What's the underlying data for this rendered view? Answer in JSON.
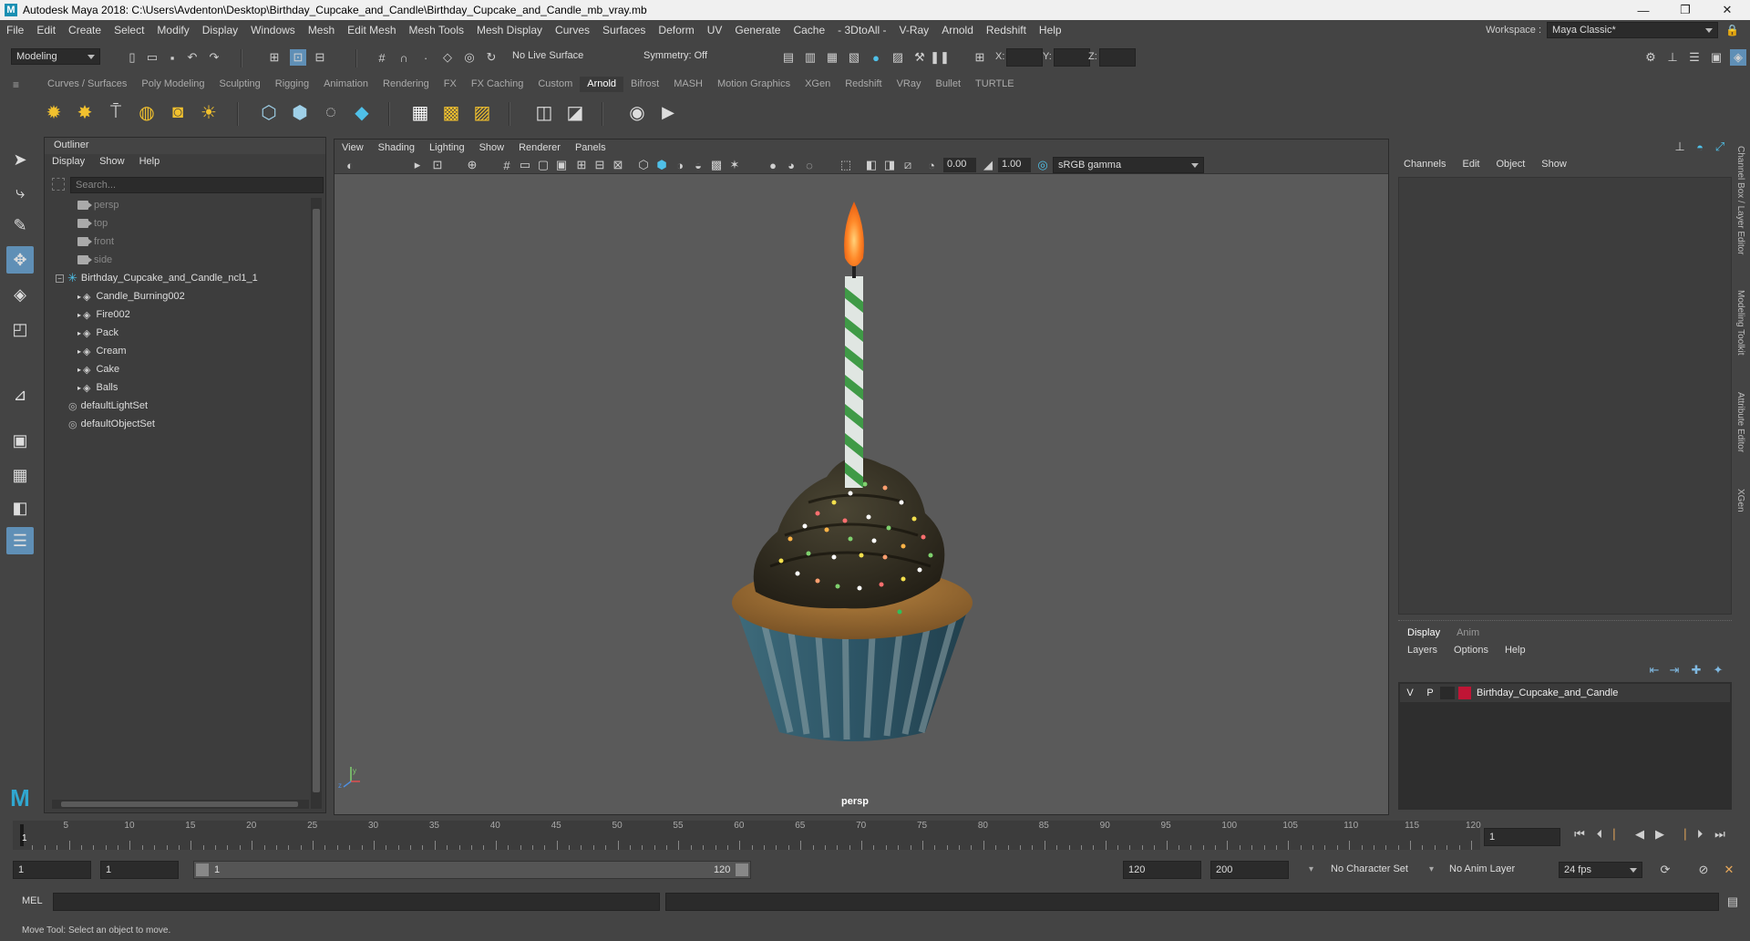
{
  "window": {
    "title": "Autodesk Maya 2018: C:\\Users\\Avdenton\\Desktop\\Birthday_Cupcake_and_Candle\\Birthday_Cupcake_and_Candle_mb_vray.mb",
    "minimize": "—",
    "maximize": "❐",
    "close": "✕"
  },
  "menubar": [
    "File",
    "Edit",
    "Create",
    "Select",
    "Modify",
    "Display",
    "Windows",
    "Mesh",
    "Edit Mesh",
    "Mesh Tools",
    "Mesh Display",
    "Curves",
    "Surfaces",
    "Deform",
    "UV",
    "Generate",
    "Cache",
    "- 3DtoAll -",
    "V-Ray",
    "Arnold",
    "Redshift",
    "Help"
  ],
  "workspace": {
    "label": "Workspace :",
    "value": "Maya Classic*"
  },
  "statusline": {
    "mode": "Modeling",
    "live_surface": "No Live Surface",
    "symmetry": "Symmetry: Off",
    "x_label": "X:",
    "y_label": "Y:",
    "z_label": "Z:"
  },
  "shelf_tabs": [
    "Curves / Surfaces",
    "Poly Modeling",
    "Sculpting",
    "Rigging",
    "Animation",
    "Rendering",
    "FX",
    "FX Caching",
    "Custom",
    "Arnold",
    "Bifrost",
    "MASH",
    "Motion Graphics",
    "XGen",
    "Redshift",
    "VRay",
    "Bullet",
    "TURTLE"
  ],
  "shelf_active": "Arnold",
  "outliner": {
    "title": "Outliner",
    "menu": [
      "Display",
      "Show",
      "Help"
    ],
    "search_placeholder": "Search...",
    "cameras": [
      "persp",
      "top",
      "front",
      "side"
    ],
    "group": "Birthday_Cupcake_and_Candle_ncl1_1",
    "children": [
      "Candle_Burning002",
      "Fire002",
      "Pack",
      "Cream",
      "Cake",
      "Balls"
    ],
    "sets": [
      "defaultLightSet",
      "defaultObjectSet"
    ]
  },
  "viewport": {
    "menu": [
      "View",
      "Shading",
      "Lighting",
      "Show",
      "Renderer",
      "Panels"
    ],
    "exposure": "0.00",
    "gamma": "1.00",
    "color_space": "sRGB gamma",
    "camera_label": "persp",
    "axis_y": "y",
    "axis_z": "z"
  },
  "channelbox": {
    "menu": [
      "Channels",
      "Edit",
      "Object",
      "Show"
    ],
    "layer_tabs": [
      "Display",
      "Anim"
    ],
    "layer_menu": [
      "Layers",
      "Options",
      "Help"
    ],
    "layer": {
      "v": "V",
      "p": "P",
      "name": "Birthday_Cupcake_and_Candle",
      "color": "#c01535"
    }
  },
  "side_tabs": [
    "Channel Box / Layer Editor",
    "Modeling Toolkit",
    "Attribute Editor",
    "XGen"
  ],
  "timeline": {
    "ticks": [
      "5",
      "10",
      "15",
      "20",
      "25",
      "30",
      "35",
      "40",
      "45",
      "50",
      "55",
      "60",
      "65",
      "70",
      "75",
      "80",
      "85",
      "90",
      "95",
      "100",
      "105",
      "110",
      "115",
      "120"
    ],
    "current_marker": "1",
    "current_frame": "1"
  },
  "range": {
    "start": "1",
    "anim_start": "1",
    "slider_start": "1",
    "slider_end": "120",
    "end": "120",
    "anim_end": "200",
    "character_set": "No Character Set",
    "anim_layer": "No Anim Layer",
    "fps": "24 fps"
  },
  "cmdline": {
    "label": "MEL"
  },
  "helpline": "Move Tool: Select an object to move."
}
